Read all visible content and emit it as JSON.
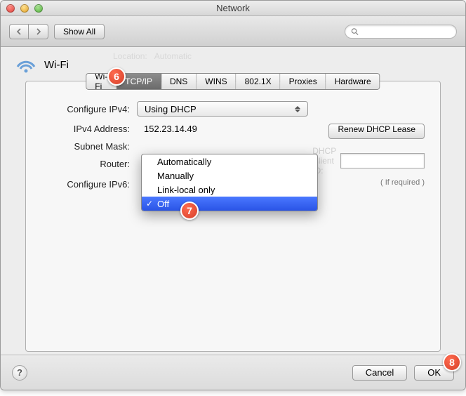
{
  "window": {
    "title": "Network"
  },
  "toolbar": {
    "show_all": "Show All",
    "search_placeholder": ""
  },
  "header": {
    "wifi_label": "Wi-Fi"
  },
  "tabs": [
    "Wi-Fi",
    "TCP/IP",
    "DNS",
    "WINS",
    "802.1X",
    "Proxies",
    "Hardware"
  ],
  "labels": {
    "configure_ipv4": "Configure IPv4:",
    "ipv4_address": "IPv4 Address:",
    "subnet_mask": "Subnet Mask:",
    "router": "Router:",
    "configure_ipv6": "Configure IPv6:",
    "dhcp_client_id": "DHCP Client ID:",
    "if_required": "( If required )",
    "renew_lease": "Renew DHCP Lease"
  },
  "values": {
    "configure_ipv4": "Using DHCP",
    "ipv4_address": "152.23.14.49"
  },
  "ipv6_menu": {
    "items": [
      "Automatically",
      "Manually",
      "Link-local only",
      "Off"
    ],
    "selected_index": 3
  },
  "footer": {
    "cancel": "Cancel",
    "ok": "OK",
    "help": "?"
  },
  "annotations": {
    "a6": "6",
    "a7": "7",
    "a8": "8"
  }
}
